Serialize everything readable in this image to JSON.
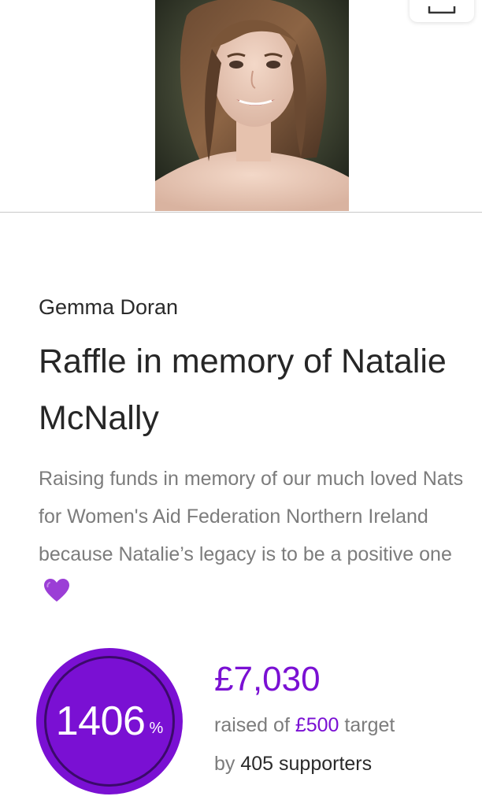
{
  "fundraiser": {
    "photo_icon": "profile-photo",
    "share_icon": "share-icon",
    "organiser": "Gemma Doran",
    "title": "Raffle in memory of Natalie McNally",
    "description": "Raising funds in memory of our much loved Nats for Women's Aid Federation Northern Ireland because Natalie’s legacy is to be a positive one",
    "description_emoji": "purple-heart-icon"
  },
  "progress": {
    "percent": "1406",
    "percent_symbol": "%",
    "raised": "£7,030",
    "raised_prefix": "raised of",
    "target": "£500",
    "target_suffix": "target",
    "by_prefix": "by",
    "supporters": "405 supporters"
  },
  "colors": {
    "accent": "#7a10d3",
    "muted_text": "#7c7c7c",
    "heart": "#9b3ed6"
  }
}
